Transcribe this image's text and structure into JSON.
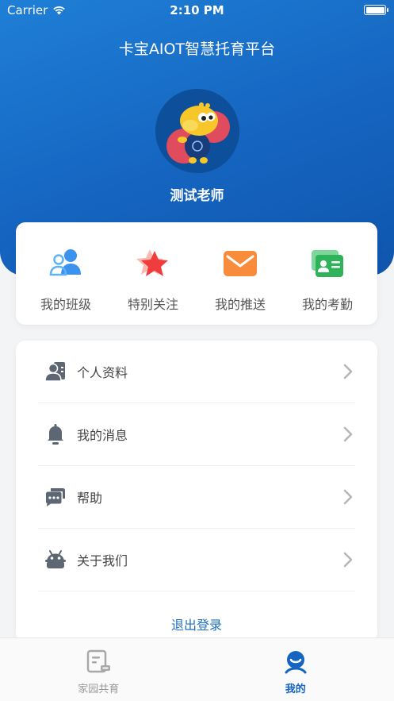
{
  "status_bar": {
    "carrier": "Carrier",
    "time": "2:10 PM"
  },
  "header": {
    "title": "卡宝AIOT智慧托育平台",
    "username": "测试老师"
  },
  "quick_actions": [
    {
      "label": "我的班级",
      "icon": "people-icon"
    },
    {
      "label": "特别关注",
      "icon": "star-icon"
    },
    {
      "label": "我的推送",
      "icon": "envelope-icon"
    },
    {
      "label": "我的考勤",
      "icon": "id-card-icon"
    }
  ],
  "menu": [
    {
      "label": "个人资料",
      "icon": "profile-card-icon"
    },
    {
      "label": "我的消息",
      "icon": "bell-icon"
    },
    {
      "label": "帮助",
      "icon": "chat-bubble-icon"
    },
    {
      "label": "关于我们",
      "icon": "robot-icon"
    }
  ],
  "logout_label": "退出登录",
  "tabbar": [
    {
      "label": "家园共育",
      "active": false
    },
    {
      "label": "我的",
      "active": true
    }
  ],
  "colors": {
    "primary": "#1565c0",
    "header_gradient_start": "#1f7fd6"
  }
}
